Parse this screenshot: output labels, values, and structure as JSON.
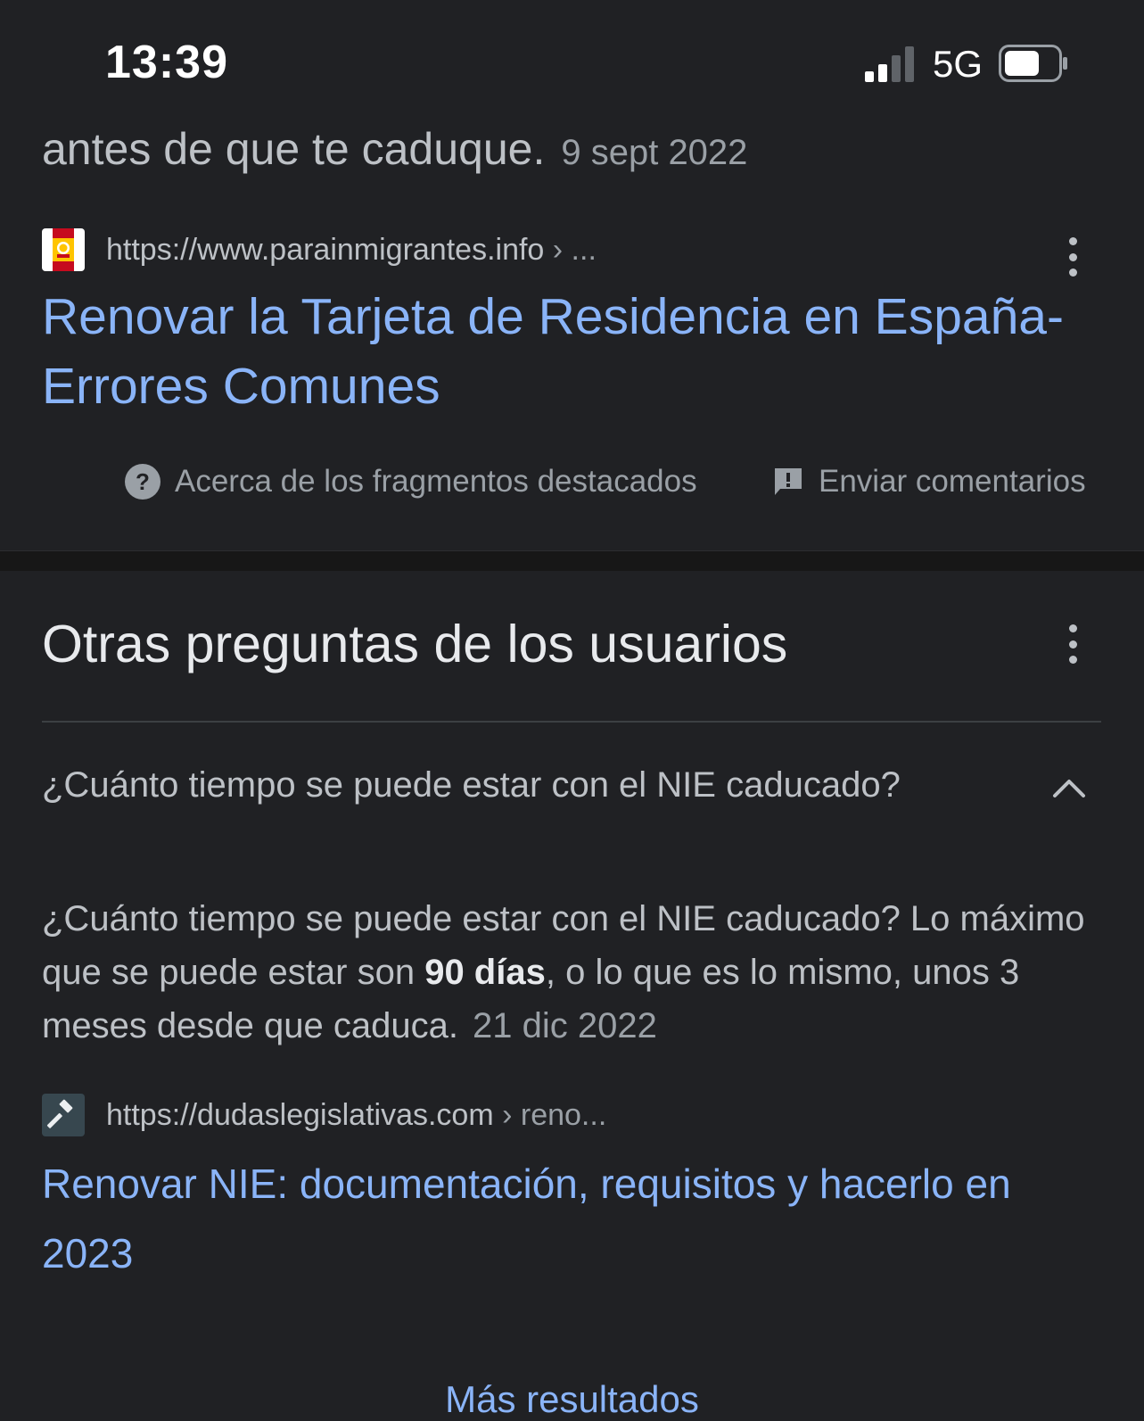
{
  "status_bar": {
    "time": "13:39",
    "network": "5G",
    "signal_bars_filled": 2,
    "signal_bars_total": 4
  },
  "snippet": {
    "tail_text": "antes de que te caduque.",
    "date": "9 sept 2022"
  },
  "result1": {
    "favicon": "spain-flag-favicon",
    "url": "https://www.parainmigrantes.info",
    "crumb": " › ...",
    "title": "Renovar la Tarjeta de Residencia en España- Errores Comunes"
  },
  "snippet_footer": {
    "about_label": "Acerca de los fragmentos destacados",
    "feedback_label": "Enviar comentarios"
  },
  "paa": {
    "title": "Otras preguntas de los usuarios",
    "question": "¿Cuánto tiempo se puede estar con el NIE caducado?",
    "answer_before": "¿Cuánto tiempo se puede estar con el NIE caducado? Lo máximo que se puede estar son ",
    "answer_bold": "90 días",
    "answer_after": ", o lo que es lo mismo, unos 3 meses desde que caduca.",
    "answer_date": "21 dic 2022"
  },
  "result2": {
    "favicon": "gavel-favicon",
    "url": "https://dudaslegislativas.com",
    "crumb": " › reno...",
    "title": "Renovar NIE: documentación, requisitos y hacerlo en 2023"
  },
  "more_results_label": "Más resultados",
  "colors": {
    "background": "#202124",
    "link": "#8ab4f8",
    "text": "#bdc1c6",
    "muted": "#9aa0a6",
    "heading": "#e8eaed"
  }
}
